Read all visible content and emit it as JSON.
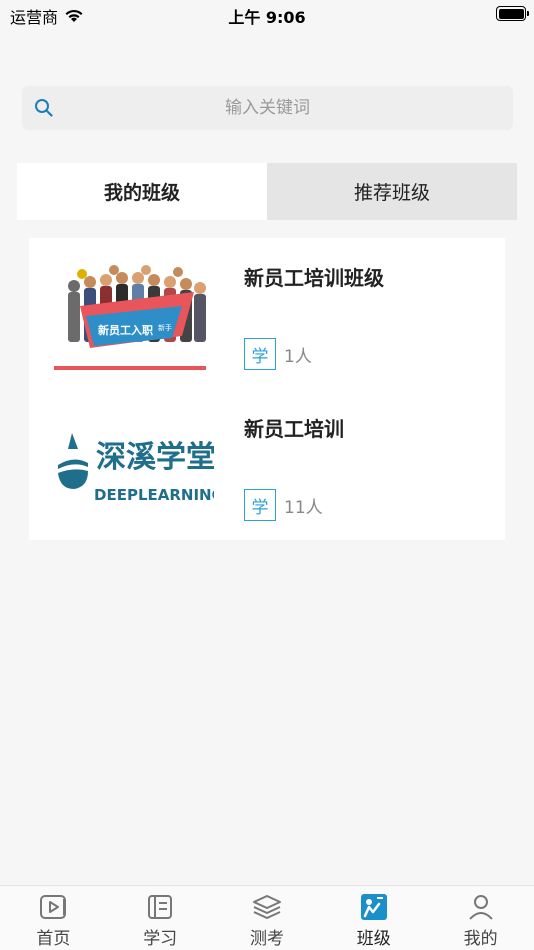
{
  "status_bar": {
    "carrier": "运营商",
    "time": "上午 9:06"
  },
  "search": {
    "placeholder": "输入关键词"
  },
  "tabs": [
    {
      "label": "我的班级",
      "active": true
    },
    {
      "label": "推荐班级",
      "active": false
    }
  ],
  "classes": [
    {
      "title": "新员工培训班级",
      "badge": "学",
      "count": "1人",
      "thumbnail_banner_text": "新员工入职",
      "thumbnail_banner_sub": "新手"
    },
    {
      "title": "新员工培训",
      "badge": "学",
      "count": "11人",
      "thumbnail_logo_cn": "深溪学堂",
      "thumbnail_logo_en": "DEEPLEARNING"
    }
  ],
  "tabbar": [
    {
      "label": "首页",
      "icon": "home-icon",
      "active": false
    },
    {
      "label": "学习",
      "icon": "study-icon",
      "active": false
    },
    {
      "label": "测考",
      "icon": "exam-icon",
      "active": false
    },
    {
      "label": "班级",
      "icon": "class-icon",
      "active": true
    },
    {
      "label": "我的",
      "icon": "profile-icon",
      "active": false
    }
  ],
  "colors": {
    "accent": "#2aa1d8",
    "background": "#f6f6f6"
  }
}
